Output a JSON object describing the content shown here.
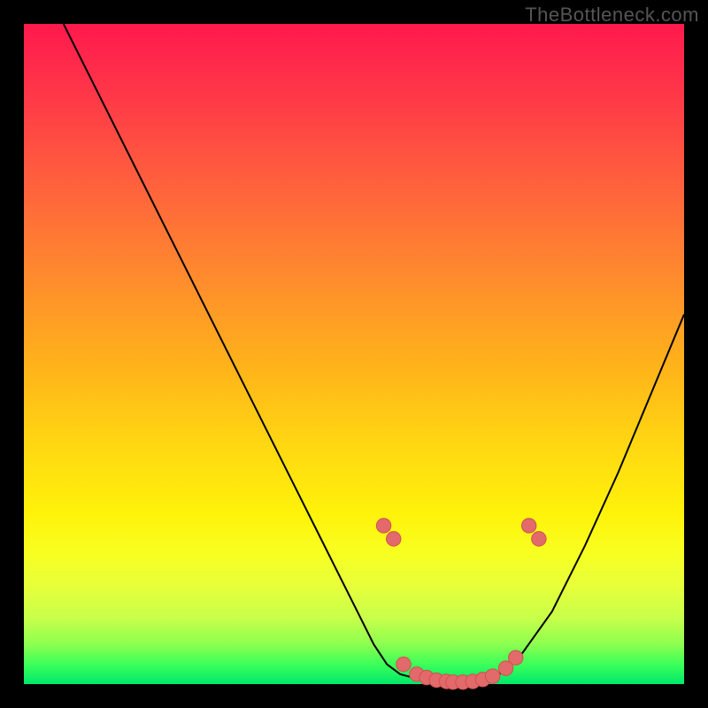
{
  "attribution": "TheBottleneck.com",
  "colors": {
    "gradient_top": "#ff1a4d",
    "gradient_mid": "#fff20a",
    "gradient_bottom": "#00e86b",
    "curve": "#000000",
    "marker_fill": "#e26a6a",
    "marker_stroke": "#d24f4f"
  },
  "chart_data": {
    "type": "line",
    "title": "",
    "xlabel": "",
    "ylabel": "",
    "xlim": [
      0,
      100
    ],
    "ylim": [
      0,
      100
    ],
    "series": [
      {
        "name": "curve",
        "x": [
          6,
          10,
          15,
          20,
          25,
          30,
          35,
          40,
          45,
          50,
          53,
          55,
          57,
          60,
          63,
          66,
          69,
          72,
          75,
          80,
          85,
          90,
          95,
          100
        ],
        "y": [
          100,
          92,
          82,
          72,
          62,
          52,
          42,
          32,
          22,
          12,
          6,
          3,
          1.5,
          0.7,
          0.3,
          0.3,
          0.6,
          1.5,
          4,
          11,
          21,
          32,
          44,
          56
        ]
      }
    ],
    "markers": {
      "name": "highlight-points",
      "x": [
        54.5,
        56,
        57.5,
        59.5,
        61,
        62.5,
        64,
        65,
        66.5,
        68,
        69.5,
        71,
        73,
        74.5,
        76.5,
        78
      ],
      "y": [
        24,
        22,
        3,
        1.5,
        1,
        0.6,
        0.4,
        0.3,
        0.3,
        0.4,
        0.7,
        1.2,
        2.4,
        4,
        24,
        22
      ]
    }
  }
}
